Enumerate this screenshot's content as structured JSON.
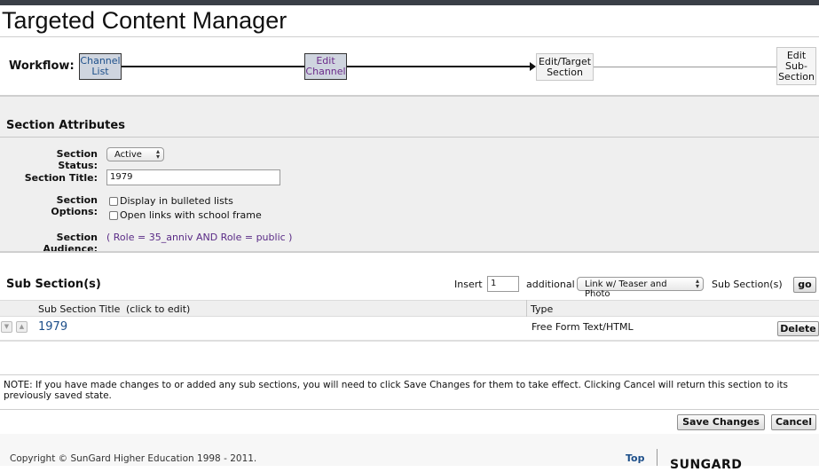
{
  "app": {
    "title": "Targeted Content Manager"
  },
  "workflow": {
    "label": "Workflow:",
    "steps": {
      "channel_list": "Channel List",
      "edit_channel": "Edit Channel",
      "edit_target_section": "Edit/Target Section",
      "edit_sub_section": "Edit Sub-Section"
    }
  },
  "attributes": {
    "heading": "Section Attributes",
    "status_label": "Section Status:",
    "status_value": "Active",
    "title_label": "Section Title:",
    "title_value": "1979",
    "options_label": "Section Options:",
    "option1": "Display in bulleted lists",
    "option2": "Open links with school frame",
    "audience_label": "Section Audience:",
    "audience_value": "( Role = 35_anniv AND Role = public )"
  },
  "subsections": {
    "heading": "Sub Section(s)",
    "insert_label": "Insert",
    "insert_value": "1",
    "additional_label": "additional",
    "type_select": "Link w/ Teaser and Photo",
    "suffix_label": "Sub Section(s)",
    "go_label": "go",
    "columns": {
      "title": "Sub Section Title",
      "title_hint": "(click to edit)",
      "type": "Type"
    },
    "rows": [
      {
        "title": "1979",
        "type": "Free Form Text/HTML",
        "delete_label": "Delete"
      }
    ]
  },
  "note": "NOTE: If you have made changes to or added any sub sections, you will need to click Save Changes for them to take effect. Clicking Cancel will return this section to its previously saved state.",
  "actions": {
    "save": "Save Changes",
    "cancel": "Cancel"
  },
  "footer": {
    "copyright": "Copyright © SunGard Higher Education 1998 - 2011.",
    "top_link": "Top",
    "logo_text": "SUNGARD"
  },
  "colors": {
    "link": "#1d4f8a",
    "visited": "#6b2a8a",
    "band": "#efefef"
  }
}
